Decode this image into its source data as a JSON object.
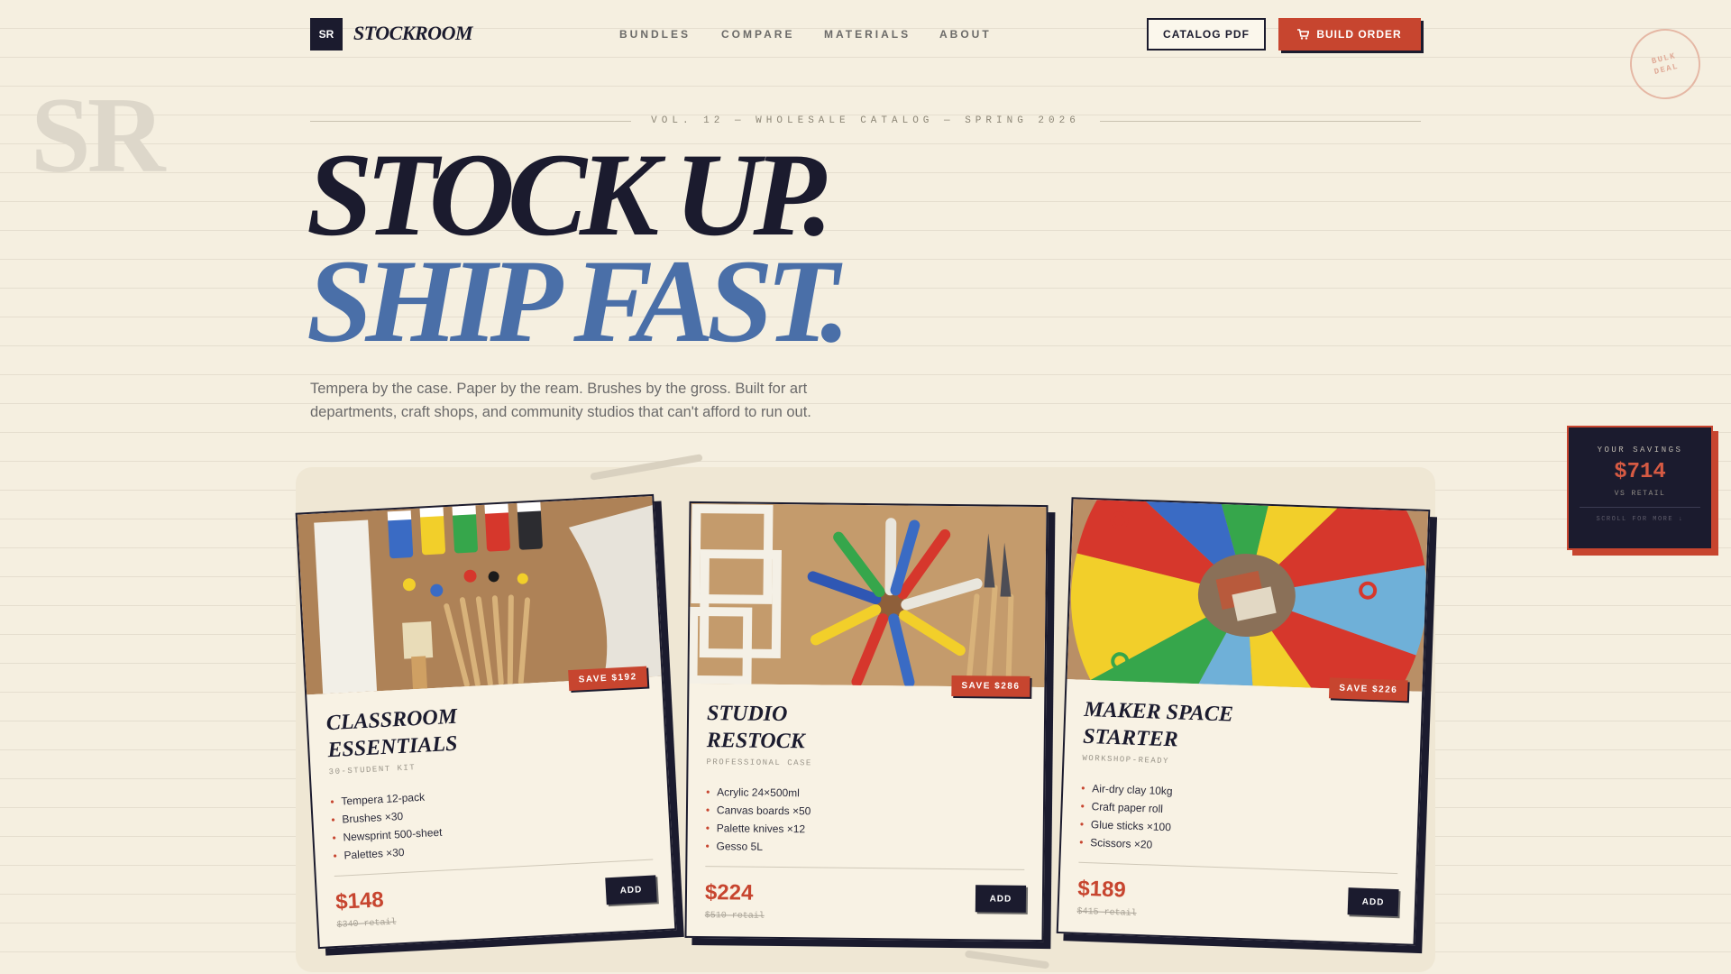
{
  "brand": {
    "logo": "SR",
    "name": "STOCKROOM",
    "watermark": "SR"
  },
  "nav": {
    "items": [
      "BUNDLES",
      "COMPARE",
      "MATERIALS",
      "ABOUT"
    ]
  },
  "actions": {
    "catalog": "CATALOG PDF",
    "build": "BUILD ORDER",
    "cart_icon": "cart-icon"
  },
  "stamp": {
    "line1": "BULK",
    "line2": "DEAL"
  },
  "hero": {
    "kicker": "VOL. 12 — WHOLESALE CATALOG — SPRING 2026",
    "line1": "STOCK UP.",
    "line2": "SHIP FAST.",
    "lede": "Tempera by the case. Paper by the ream. Brushes by the gross. Built for art departments, craft shops, and community studios that can't afford to run out."
  },
  "savings": {
    "label": "YOUR SAVINGS",
    "amount": "$714",
    "sub": "VS RETAIL",
    "scroll": "SCROLL FOR MORE ↓"
  },
  "products": [
    {
      "title_line1": "CLASSROOM",
      "title_line2": "ESSENTIALS",
      "subtitle": "30-STUDENT KIT",
      "save": "SAVE $192",
      "items": [
        "Tempera 12-pack",
        "Brushes ×30",
        "Newsprint 500-sheet",
        "Palettes ×30"
      ],
      "price": "$148",
      "retail": "$340 retail",
      "add": "ADD"
    },
    {
      "title_line1": "STUDIO",
      "title_line2": "RESTOCK",
      "subtitle": "PROFESSIONAL CASE",
      "save": "SAVE $286",
      "items": [
        "Acrylic 24×500ml",
        "Canvas boards ×50",
        "Palette knives ×12",
        "Gesso 5L"
      ],
      "price": "$224",
      "retail": "$510 retail",
      "add": "ADD"
    },
    {
      "title_line1": "MAKER SPACE",
      "title_line2": "STARTER",
      "subtitle": "WORKSHOP-READY",
      "save": "SAVE $226",
      "items": [
        "Air-dry clay 10kg",
        "Craft paper roll",
        "Glue sticks ×100",
        "Scissors ×20"
      ],
      "price": "$189",
      "retail": "$415 retail",
      "add": "ADD"
    }
  ],
  "colors": {
    "ink": "#1b1b2e",
    "accent_red": "#c7452f",
    "accent_blue": "#4a6fa8",
    "paper": "#f5efe0"
  }
}
